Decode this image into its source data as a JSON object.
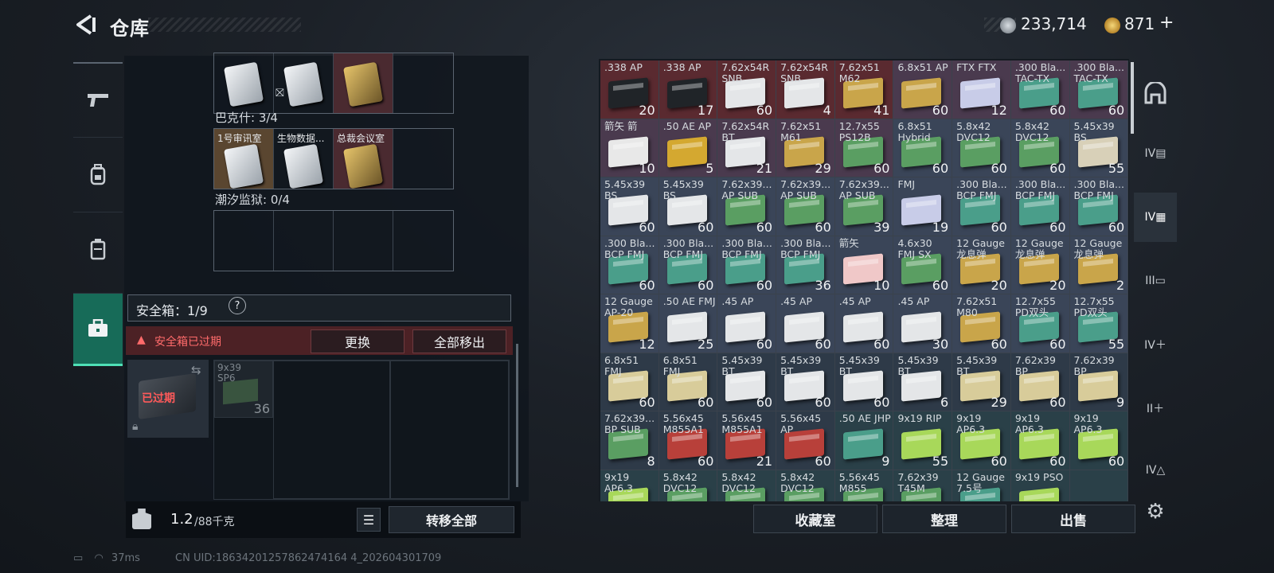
{
  "header": {
    "title": "仓库",
    "currency1": "233,714",
    "currency2": "871"
  },
  "left": {
    "row1": [
      {
        "t": "",
        "c": "white"
      },
      {
        "t": "",
        "c": "white"
      },
      {
        "t": "",
        "c": "gold"
      },
      {
        "t": "",
        "c": "empty"
      }
    ],
    "lbl1": "巴克什: 3/4",
    "row2": [
      {
        "t": "1号审讯室",
        "c": "white"
      },
      {
        "t": "生物数据...",
        "c": "white"
      },
      {
        "t": "总裁会议室",
        "c": "gold"
      },
      {
        "t": "",
        "c": "empty"
      }
    ],
    "lbl2": "潮汐监狱: 0/4",
    "safe_title": "安全箱：1/9",
    "safe_help": "?",
    "expired_msg": "安全箱已过期",
    "btn_replace": "更换",
    "btn_remove_all": "全部移出",
    "safe_item_label": "已过期",
    "safe_ammo": {
      "name": "9x39 SP6",
      "qty": "36"
    },
    "weight": "1.2",
    "weight_max": "/88千克",
    "btn_transfer_all": "转移全部"
  },
  "items": [
    {
      "n": ".338 AP",
      "q": "20",
      "c": "#202428",
      "bg": "#5a2a30"
    },
    {
      "n": ".338 AP",
      "q": "17",
      "c": "#202428",
      "bg": "#5a2a30"
    },
    {
      "n": "7.62x54R SNB",
      "q": "60",
      "c": "#e4e6e8",
      "bg": "#5a2a30"
    },
    {
      "n": "7.62x54R SNB",
      "q": "4",
      "c": "#e4e6e8",
      "bg": "#5a2a30"
    },
    {
      "n": "7.62x51 M62",
      "q": "41",
      "c": "#c9a54a",
      "bg": "#5a2a30"
    },
    {
      "n": "6.8x51 AP",
      "q": "60",
      "c": "#c9a54a",
      "bg": "#4a3a4e"
    },
    {
      "n": "FTX FTX",
      "q": "12",
      "c": "#c8cce8",
      "bg": "#4a3a4e"
    },
    {
      "n": ".300 Bla... TAC-TX",
      "q": "60",
      "c": "#4a9e8a",
      "bg": "#4a3a4e"
    },
    {
      "n": ".300 Bla... TAC-TX",
      "q": "60",
      "c": "#4a9e8a",
      "bg": "#4a3a4e"
    },
    {
      "n": "箭矢 箭",
      "q": "10",
      "c": "#e8e8e8",
      "bg": "#4a3a4e"
    },
    {
      "n": ".50 AE AP",
      "q": "5",
      "c": "#d4a830",
      "bg": "#4a3a4e"
    },
    {
      "n": "7.62x54R BT",
      "q": "21",
      "c": "#e4e6e8",
      "bg": "#4a3a4e"
    },
    {
      "n": "7.62x51 M61",
      "q": "29",
      "c": "#c9a54a",
      "bg": "#4a3a4e"
    },
    {
      "n": "12.7x55 PS12B",
      "q": "60",
      "c": "#5a9e62",
      "bg": "#4a3a4e"
    },
    {
      "n": "6.8x51 Hybrid",
      "q": "60",
      "c": "#5a9e62",
      "bg": "#3a4558"
    },
    {
      "n": "5.8x42 DVC12",
      "q": "60",
      "c": "#5a9e62",
      "bg": "#3a4558"
    },
    {
      "n": "5.8x42 DVC12",
      "q": "60",
      "c": "#5a9e62",
      "bg": "#3a4558"
    },
    {
      "n": "5.45x39 BS",
      "q": "55",
      "c": "#d8d0b8",
      "bg": "#3a4558"
    },
    {
      "n": "5.45x39 BS",
      "q": "60",
      "c": "#e4e6e8",
      "bg": "#3a4558"
    },
    {
      "n": "5.45x39 BS",
      "q": "60",
      "c": "#e4e6e8",
      "bg": "#3a4558"
    },
    {
      "n": "7.62x39... AP SUB",
      "q": "60",
      "c": "#5a9e62",
      "bg": "#3a4558"
    },
    {
      "n": "7.62x39... AP SUB",
      "q": "60",
      "c": "#5a9e62",
      "bg": "#3a4558"
    },
    {
      "n": "7.62x39... AP SUB",
      "q": "39",
      "c": "#5a9e62",
      "bg": "#3a4558"
    },
    {
      "n": "FMJ",
      "q": "19",
      "c": "#c8cce8",
      "bg": "#3a4558"
    },
    {
      "n": ".300 Bla... BCP FMJ",
      "q": "60",
      "c": "#4a9e8a",
      "bg": "#3a4558"
    },
    {
      "n": ".300 Bla... BCP FMJ",
      "q": "60",
      "c": "#4a9e8a",
      "bg": "#3a4558"
    },
    {
      "n": ".300 Bla... BCP FMJ",
      "q": "60",
      "c": "#4a9e8a",
      "bg": "#3a4558"
    },
    {
      "n": ".300 Bla... BCP FMJ",
      "q": "60",
      "c": "#4a9e8a",
      "bg": "#3a4558"
    },
    {
      "n": ".300 Bla... BCP FMJ",
      "q": "60",
      "c": "#4a9e8a",
      "bg": "#3a4558"
    },
    {
      "n": ".300 Bla... BCP FMJ",
      "q": "60",
      "c": "#4a9e8a",
      "bg": "#3a4558"
    },
    {
      "n": ".300 Bla... BCP FMJ",
      "q": "36",
      "c": "#4a9e8a",
      "bg": "#3a4558"
    },
    {
      "n": "箭矢",
      "q": "10",
      "c": "#f0c8c8",
      "bg": "#3a4558"
    },
    {
      "n": "4.6x30 FMJ SX",
      "q": "60",
      "c": "#5a9e62",
      "bg": "#3a4558"
    },
    {
      "n": "12 Gauge 龙息弹",
      "q": "20",
      "c": "#c9a54a",
      "bg": "#3a4558"
    },
    {
      "n": "12 Gauge 龙息弹",
      "q": "20",
      "c": "#c9a54a",
      "bg": "#3a4558"
    },
    {
      "n": "12 Gauge 龙息弹",
      "q": "2",
      "c": "#c9a54a",
      "bg": "#3a4558"
    },
    {
      "n": "12 Gauge AP-20",
      "q": "12",
      "c": "#c9a54a",
      "bg": "#3a4558"
    },
    {
      "n": ".50 AE FMJ",
      "q": "25",
      "c": "#e4e6e8",
      "bg": "#3a4558"
    },
    {
      "n": ".45 AP",
      "q": "60",
      "c": "#e4e6e8",
      "bg": "#3a4558"
    },
    {
      "n": ".45 AP",
      "q": "60",
      "c": "#e4e6e8",
      "bg": "#3a4558"
    },
    {
      "n": ".45 AP",
      "q": "60",
      "c": "#e4e6e8",
      "bg": "#3a4558"
    },
    {
      "n": ".45 AP",
      "q": "30",
      "c": "#e4e6e8",
      "bg": "#3a4558"
    },
    {
      "n": "7.62x51 M80",
      "q": "60",
      "c": "#c9a54a",
      "bg": "#3a4558"
    },
    {
      "n": "12.7x55 PD双头",
      "q": "60",
      "c": "#4a9e8a",
      "bg": "#3a4558"
    },
    {
      "n": "12.7x55 PD双头",
      "q": "55",
      "c": "#4a9e8a",
      "bg": "#3a4558"
    },
    {
      "n": "6.8x51 FMJ",
      "q": "60",
      "c": "#d8cc9a",
      "bg": "#2e3a48"
    },
    {
      "n": "6.8x51 FMJ",
      "q": "60",
      "c": "#d8cc9a",
      "bg": "#2e3a48"
    },
    {
      "n": "5.45x39 BT",
      "q": "60",
      "c": "#e4e6e8",
      "bg": "#2e3a48"
    },
    {
      "n": "5.45x39 BT",
      "q": "60",
      "c": "#e4e6e8",
      "bg": "#2e3a48"
    },
    {
      "n": "5.45x39 BT",
      "q": "60",
      "c": "#e4e6e8",
      "bg": "#2e3a48"
    },
    {
      "n": "5.45x39 BT",
      "q": "6",
      "c": "#e4e6e8",
      "bg": "#2e3a48"
    },
    {
      "n": "5.45x39 BT",
      "q": "29",
      "c": "#d8cc9a",
      "bg": "#2e3a48"
    },
    {
      "n": "7.62x39 BP",
      "q": "60",
      "c": "#d8cc9a",
      "bg": "#2e3a48"
    },
    {
      "n": "7.62x39 BP",
      "q": "9",
      "c": "#d8cc9a",
      "bg": "#2e3a48"
    },
    {
      "n": "7.62x39... BP SUB",
      "q": "8",
      "c": "#5a9e62",
      "bg": "#2e3a48"
    },
    {
      "n": "5.56x45 M855A1",
      "q": "60",
      "c": "#b8403a",
      "bg": "#2e3a48"
    },
    {
      "n": "5.56x45 M855A1",
      "q": "21",
      "c": "#b8403a",
      "bg": "#2e3a48"
    },
    {
      "n": "5.56x45 AP",
      "q": "60",
      "c": "#b8403a",
      "bg": "#2e3a48"
    },
    {
      "n": ".50 AE JHP",
      "q": "9",
      "c": "#4a9e8a",
      "bg": "#2a4048"
    },
    {
      "n": "9x19 RIP",
      "q": "55",
      "c": "#a8d85a",
      "bg": "#2a4048"
    },
    {
      "n": "9x19 AP6.3",
      "q": "60",
      "c": "#a8d85a",
      "bg": "#2a4048"
    },
    {
      "n": "9x19 AP6.3",
      "q": "60",
      "c": "#a8d85a",
      "bg": "#2a4048"
    },
    {
      "n": "9x19 AP6.3",
      "q": "60",
      "c": "#a8d85a",
      "bg": "#2a4048"
    },
    {
      "n": "9x19 AP6.3",
      "q": "",
      "c": "#a8d85a",
      "bg": "#2a4048"
    },
    {
      "n": "5.8x42 DVC12",
      "q": "",
      "c": "#5a9e62",
      "bg": "#2a4048"
    },
    {
      "n": "5.8x42 DVC12",
      "q": "",
      "c": "#5a9e62",
      "bg": "#2a4048"
    },
    {
      "n": "5.8x42 DVC12",
      "q": "",
      "c": "#5a9e62",
      "bg": "#2a4048"
    },
    {
      "n": "5.56x45 M855",
      "q": "",
      "c": "#5a9e62",
      "bg": "#2a4048"
    },
    {
      "n": "7.62x39 T45M",
      "q": "",
      "c": "#5a9e62",
      "bg": "#2a4048"
    },
    {
      "n": "12 Gauge 7.5号",
      "q": "",
      "c": "#4a9e8a",
      "bg": "#2a4048"
    },
    {
      "n": "9x19 PSO",
      "q": "",
      "c": "#a8d85a",
      "bg": "#2a4048"
    },
    {
      "n": "",
      "q": "",
      "c": "",
      "bg": "#2a4048"
    }
  ],
  "right_buttons": {
    "collection": "收藏室",
    "organize": "整理",
    "sell": "出售"
  },
  "status": {
    "ping": "37ms",
    "uid": "CN UID:18634201257862474164 4_202604301709"
  }
}
